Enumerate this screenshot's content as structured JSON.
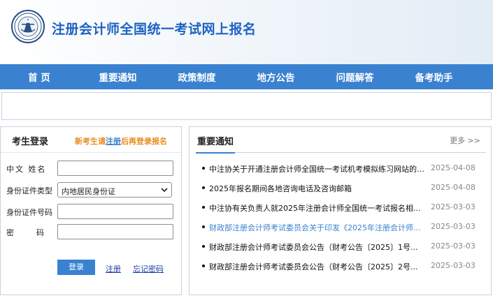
{
  "header": {
    "title": "注册会计师全国统一考试网上报名",
    "logo_icon": "cicpa-emblem-icon"
  },
  "nav": {
    "items": [
      "首 页",
      "重要通知",
      "政策制度",
      "地方公告",
      "问题解答",
      "备考助手"
    ]
  },
  "login": {
    "title": "考生登录",
    "tip_prefix": "新考生请",
    "tip_link": "注册",
    "tip_suffix": "后再登录报名",
    "fields": {
      "name_label": "中文 姓名",
      "idtype_label": "身份证件类型",
      "idtype_value": "内地居民身份证",
      "idnum_label": "身份证件号码",
      "password_label": "密码"
    },
    "login_button": "登录",
    "register_link": "注册",
    "forgot_link": "忘记密码"
  },
  "news": {
    "title": "重要通知",
    "more": "更多 >>",
    "items": [
      {
        "text": "中注协关于开通注册会计师全国统一考试机考模拟练习网站的公...",
        "date": "2025-04-08"
      },
      {
        "text": "2025年报名期间各地咨询电话及咨询邮箱",
        "date": "2025-04-08"
      },
      {
        "text": "中注协有关负责人就2025年注册会计师全国统一考试报名相...",
        "date": "2025-03-03"
      },
      {
        "text": "财政部注册会计师考试委员会关于印发《2025年注册会计师...",
        "date": "2025-03-03"
      },
      {
        "text": "财政部注册会计师考试委员会公告（财考公告〔2025〕1号...",
        "date": "2025-03-03"
      },
      {
        "text": "财政部注册会计师考试委员会公告（财考公告〔2025〕2号...",
        "date": "2025-03-03"
      }
    ]
  },
  "colors": {
    "brand_blue": "#3a82d0",
    "title_blue": "#1e63c3",
    "tip_orange": "#e88c1c"
  }
}
